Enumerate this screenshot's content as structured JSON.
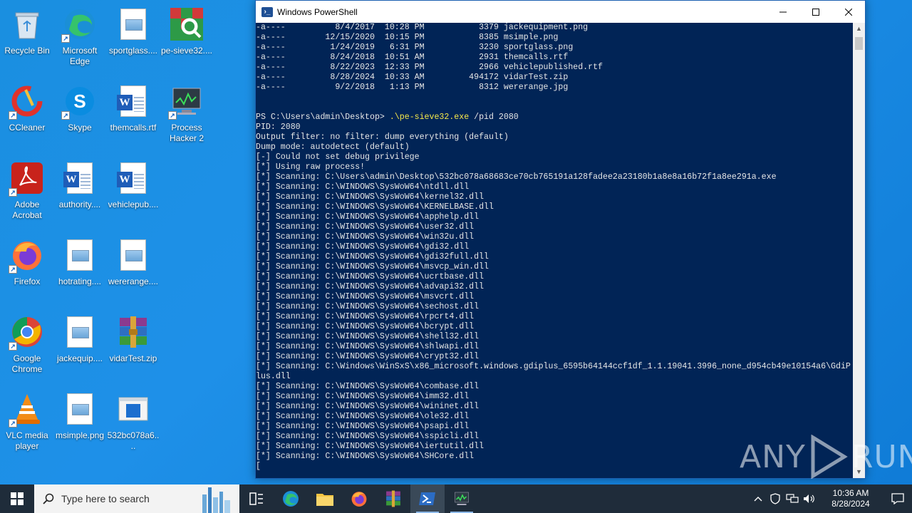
{
  "desktop": {
    "icons": [
      {
        "label": "Recycle Bin"
      },
      {
        "label": "Microsoft Edge"
      },
      {
        "label": "sportglass...."
      },
      {
        "label": "pe-sieve32...."
      },
      {
        "label": "CCleaner"
      },
      {
        "label": "Skype"
      },
      {
        "label": "themcalls.rtf"
      },
      {
        "label": "Process Hacker 2"
      },
      {
        "label": "Adobe Acrobat"
      },
      {
        "label": "authority...."
      },
      {
        "label": "vehiclepub...."
      },
      {
        "label": "Firefox"
      },
      {
        "label": "hotrating...."
      },
      {
        "label": "wererange...."
      },
      {
        "label": "Google Chrome"
      },
      {
        "label": "jackequip...."
      },
      {
        "label": "vidarTest.zip"
      },
      {
        "label": "VLC media player"
      },
      {
        "label": "msimple.png"
      },
      {
        "label": "532bc078a6...."
      }
    ]
  },
  "powershell": {
    "title": "Windows PowerShell",
    "lines": [
      "-a----          8/4/2017  10:28 PM           3379 jackequipment.png",
      "-a----        12/15/2020  10:15 PM           8385 msimple.png",
      "-a----         1/24/2019   6:31 PM           3230 sportglass.png",
      "-a----         8/24/2018  10:51 AM           2931 themcalls.rtf",
      "-a----         8/22/2023  12:33 PM           2966 vehiclepublished.rtf",
      "-a----         8/28/2024  10:33 AM         494172 vidarTest.zip",
      "-a----          9/2/2018   1:13 PM           8312 wererange.jpg",
      "",
      "",
      "PID: 2080",
      "Output filter: no filter: dump everything (default)",
      "Dump mode: autodetect (default)",
      "[-] Could not set debug privilege",
      "[*] Using raw process!",
      "[*] Scanning: C:\\Users\\admin\\Desktop\\532bc078a68683ce70cb765191a128fadee2a23180b1a8e8a16b72f1a8ee291a.exe",
      "[*] Scanning: C:\\WINDOWS\\SysWoW64\\ntdll.dll",
      "[*] Scanning: C:\\WINDOWS\\SysWoW64\\kernel32.dll",
      "[*] Scanning: C:\\WINDOWS\\SysWoW64\\KERNELBASE.dll",
      "[*] Scanning: C:\\WINDOWS\\SysWoW64\\apphelp.dll",
      "[*] Scanning: C:\\WINDOWS\\SysWoW64\\user32.dll",
      "[*] Scanning: C:\\WINDOWS\\SysWoW64\\win32u.dll",
      "[*] Scanning: C:\\WINDOWS\\SysWoW64\\gdi32.dll",
      "[*] Scanning: C:\\WINDOWS\\SysWoW64\\gdi32full.dll",
      "[*] Scanning: C:\\WINDOWS\\SysWoW64\\msvcp_win.dll",
      "[*] Scanning: C:\\WINDOWS\\SysWoW64\\ucrtbase.dll",
      "[*] Scanning: C:\\WINDOWS\\SysWoW64\\advapi32.dll",
      "[*] Scanning: C:\\WINDOWS\\SysWoW64\\msvcrt.dll",
      "[*] Scanning: C:\\WINDOWS\\SysWoW64\\sechost.dll",
      "[*] Scanning: C:\\WINDOWS\\SysWoW64\\rpcrt4.dll",
      "[*] Scanning: C:\\WINDOWS\\SysWoW64\\bcrypt.dll",
      "[*] Scanning: C:\\WINDOWS\\SysWoW64\\shell32.dll",
      "[*] Scanning: C:\\WINDOWS\\SysWoW64\\shlwapi.dll",
      "[*] Scanning: C:\\WINDOWS\\SysWoW64\\crypt32.dll",
      "[*] Scanning: C:\\Windows\\WinSxS\\x86_microsoft.windows.gdiplus_6595b64144ccf1df_1.1.19041.3996_none_d954cb49e10154a6\\GdiP",
      "lus.dll",
      "[*] Scanning: C:\\WINDOWS\\SysWoW64\\combase.dll",
      "[*] Scanning: C:\\WINDOWS\\SysWoW64\\imm32.dll",
      "[*] Scanning: C:\\WINDOWS\\SysWoW64\\wininet.dll",
      "[*] Scanning: C:\\WINDOWS\\SysWoW64\\ole32.dll",
      "[*] Scanning: C:\\WINDOWS\\SysWoW64\\psapi.dll",
      "[*] Scanning: C:\\WINDOWS\\SysWoW64\\sspicli.dll",
      "[*] Scanning: C:\\WINDOWS\\SysWoW64\\iertutil.dll",
      "[*] Scanning: C:\\WINDOWS\\SysWoW64\\SHCore.dll",
      "["
    ],
    "prompt": "PS C:\\Users\\admin\\Desktop> ",
    "command": ".\\pe-sieve32.exe",
    "command_args": " /pid 2080"
  },
  "watermark": {
    "left": "ANY",
    "right": "RUN"
  },
  "taskbar": {
    "search_placeholder": "Type here to search",
    "clock_time": "10:36 AM",
    "clock_date": "8/28/2024"
  }
}
